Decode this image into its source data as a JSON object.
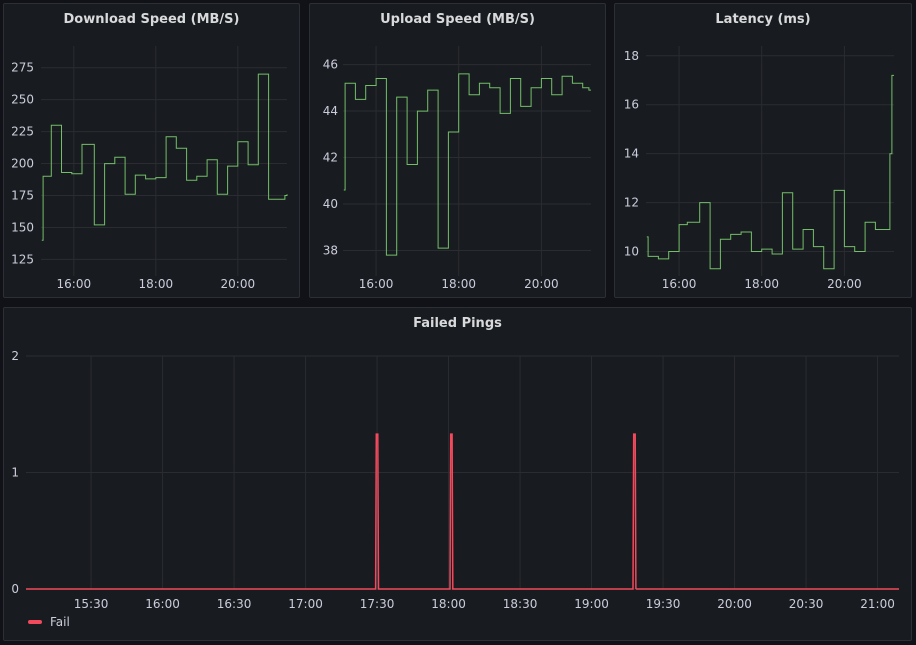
{
  "colors": {
    "green": "#73bf69",
    "red": "#f2495c",
    "grid": "#2a2c31",
    "tick": "#ccccdc"
  },
  "chart_data": [
    {
      "type": "line",
      "title": "Download Speed (MB/S)",
      "xlim": [
        15.2,
        21.2
      ],
      "ylim": [
        112,
        292
      ],
      "yticks": [
        125,
        150,
        175,
        200,
        225,
        250,
        275
      ],
      "xticks": [
        {
          "v": 16,
          "label": "16:00"
        },
        {
          "v": 18,
          "label": "18:00"
        },
        {
          "v": 20,
          "label": "20:00"
        }
      ],
      "series": [
        {
          "color": "#73bf69",
          "x": [
            15.22,
            15.25,
            15.45,
            15.7,
            15.95,
            16.2,
            16.5,
            16.75,
            17.0,
            17.25,
            17.5,
            17.75,
            18.0,
            18.25,
            18.5,
            18.75,
            19.0,
            19.25,
            19.5,
            19.75,
            20.0,
            20.25,
            20.5,
            20.75,
            21.0,
            21.15,
            21.2
          ],
          "y": [
            140,
            190,
            230,
            193,
            192,
            215,
            152,
            200,
            205,
            176,
            191,
            188,
            189,
            221,
            212,
            187,
            190,
            203,
            176,
            198,
            217,
            199,
            270,
            172,
            172,
            175,
            176
          ]
        }
      ]
    },
    {
      "type": "line",
      "title": "Upload Speed (MB/S)",
      "xlim": [
        15.2,
        21.2
      ],
      "ylim": [
        36.9,
        46.8
      ],
      "yticks": [
        38,
        40,
        42,
        44,
        46
      ],
      "xticks": [
        {
          "v": 16,
          "label": "16:00"
        },
        {
          "v": 18,
          "label": "18:00"
        },
        {
          "v": 20,
          "label": "20:00"
        }
      ],
      "series": [
        {
          "color": "#73bf69",
          "x": [
            15.22,
            15.25,
            15.5,
            15.75,
            16.0,
            16.25,
            16.5,
            16.75,
            17.0,
            17.25,
            17.5,
            17.75,
            18.0,
            18.25,
            18.5,
            18.75,
            19.0,
            19.25,
            19.5,
            19.75,
            20.0,
            20.25,
            20.5,
            20.75,
            21.0,
            21.15,
            21.2
          ],
          "y": [
            40.6,
            45.2,
            44.5,
            45.1,
            45.4,
            37.8,
            44.6,
            41.7,
            44.0,
            44.9,
            38.1,
            43.1,
            45.6,
            44.7,
            45.2,
            45.0,
            43.9,
            45.4,
            44.2,
            45.0,
            45.4,
            44.7,
            45.5,
            45.2,
            45.0,
            44.9,
            44.9
          ]
        }
      ]
    },
    {
      "type": "line",
      "title": "Latency (ms)",
      "xlim": [
        15.2,
        21.2
      ],
      "ylim": [
        9.0,
        18.4
      ],
      "yticks": [
        10,
        12,
        14,
        16,
        18
      ],
      "xticks": [
        {
          "v": 16,
          "label": "16:00"
        },
        {
          "v": 18,
          "label": "18:00"
        },
        {
          "v": 20,
          "label": "20:00"
        }
      ],
      "series": [
        {
          "color": "#73bf69",
          "x": [
            15.22,
            15.25,
            15.5,
            15.75,
            16.0,
            16.2,
            16.5,
            16.75,
            17.0,
            17.25,
            17.5,
            17.75,
            18.0,
            18.25,
            18.5,
            18.75,
            19.0,
            19.25,
            19.5,
            19.75,
            20.0,
            20.25,
            20.5,
            20.75,
            21.0,
            21.1,
            21.15,
            21.2
          ],
          "y": [
            10.6,
            9.8,
            9.7,
            10.0,
            11.1,
            11.2,
            12.0,
            9.3,
            10.5,
            10.7,
            10.8,
            10.0,
            10.1,
            9.9,
            12.4,
            10.1,
            10.9,
            10.2,
            9.3,
            12.5,
            10.2,
            10.0,
            11.2,
            10.9,
            10.9,
            14.0,
            17.2,
            17.2
          ]
        }
      ]
    },
    {
      "type": "line",
      "title": "Failed Pings",
      "xlim": [
        15.045,
        21.15
      ],
      "ylim": [
        0,
        2
      ],
      "yticks": [
        0,
        1,
        2
      ],
      "xticks": [
        {
          "v": 15.5,
          "label": "15:30"
        },
        {
          "v": 16.0,
          "label": "16:00"
        },
        {
          "v": 16.5,
          "label": "16:30"
        },
        {
          "v": 17.0,
          "label": "17:00"
        },
        {
          "v": 17.5,
          "label": "17:30"
        },
        {
          "v": 18.0,
          "label": "18:00"
        },
        {
          "v": 18.5,
          "label": "18:30"
        },
        {
          "v": 19.0,
          "label": "19:00"
        },
        {
          "v": 19.5,
          "label": "19:30"
        },
        {
          "v": 20.0,
          "label": "20:00"
        },
        {
          "v": 20.5,
          "label": "20:30"
        },
        {
          "v": 21.0,
          "label": "21:00"
        }
      ],
      "legend": [
        {
          "label": "Fail",
          "color": "#f2495c"
        }
      ],
      "series": [
        {
          "name": "Fail",
          "color": "#f2495c",
          "x": [
            15.045,
            17.49,
            17.495,
            17.505,
            17.51,
            18.01,
            18.015,
            18.025,
            18.03,
            19.29,
            19.295,
            19.305,
            19.31
          ],
          "y": [
            0,
            0,
            1.33,
            1.33,
            0,
            0,
            1.33,
            1.33,
            0,
            0,
            1.33,
            1.33,
            0
          ]
        }
      ]
    }
  ]
}
